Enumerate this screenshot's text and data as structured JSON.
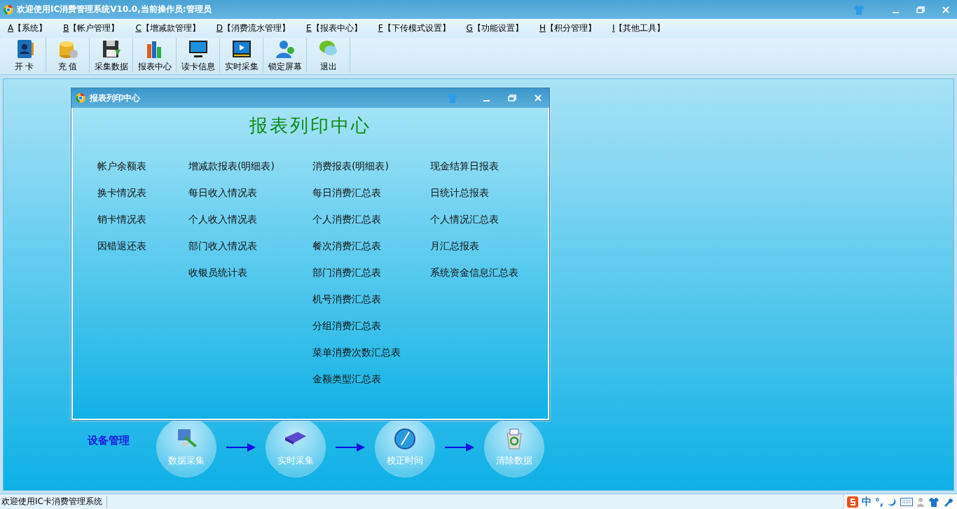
{
  "window": {
    "title": "欢迎使用IC消费管理系统V10.0,当前操作员:管理员"
  },
  "menu": [
    {
      "key": "A",
      "label": "【系统】"
    },
    {
      "key": "B",
      "label": "【帐户管理】"
    },
    {
      "key": "C",
      "label": "【增减款管理】"
    },
    {
      "key": "D",
      "label": "【消费流水管理】"
    },
    {
      "key": "E",
      "label": "【报表中心】"
    },
    {
      "key": "F",
      "label": "【下传模式设置】"
    },
    {
      "key": "G",
      "label": "【功能设置】"
    },
    {
      "key": "H",
      "label": "【积分管理】"
    },
    {
      "key": "I",
      "label": "【其他工具】"
    }
  ],
  "toolbar": [
    {
      "kind": "card",
      "label": "开 卡"
    },
    {
      "kind": "coins",
      "label": "充 值"
    },
    {
      "kind": "disk",
      "label": "采集数据"
    },
    {
      "kind": "chart",
      "label": "报表中心"
    },
    {
      "kind": "monitor",
      "label": "读卡信息"
    },
    {
      "kind": "video",
      "label": "实时采集"
    },
    {
      "kind": "user",
      "label": "锁定屏幕"
    },
    {
      "kind": "chat",
      "label": "退出"
    }
  ],
  "child_window": {
    "title": "报表列印中心",
    "heading": "报表列印中心",
    "columns": [
      [
        "帐户余额表",
        "换卡情况表",
        "销卡情况表",
        "因错退还表"
      ],
      [
        "增减款报表(明细表)",
        "每日收入情况表",
        "个人收入情况表",
        "部门收入情况表",
        "收银员统计表"
      ],
      [
        "消费报表(明细表)",
        "每日消费汇总表",
        "个人消费汇总表",
        "餐次消费汇总表",
        "部门消费汇总表",
        "机号消费汇总表",
        "分组消费汇总表",
        "菜单消费次数汇总表",
        "金额类型汇总表"
      ],
      [
        "现金结算日报表",
        "日统计总报表",
        "个人情况汇总表",
        "月汇总报表",
        "系统资金信息汇总表"
      ]
    ]
  },
  "device": {
    "title": "设备管理",
    "steps": [
      {
        "kind": "monitor",
        "label": "数据采集"
      },
      {
        "kind": "drive",
        "label": "实时采集"
      },
      {
        "kind": "clock",
        "label": "校正时间"
      },
      {
        "kind": "bin",
        "label": "清除数据"
      }
    ]
  },
  "status_bar": {
    "text": "欢迎使用IC卡消费管理系统",
    "ime": [
      "中",
      "°,"
    ]
  }
}
